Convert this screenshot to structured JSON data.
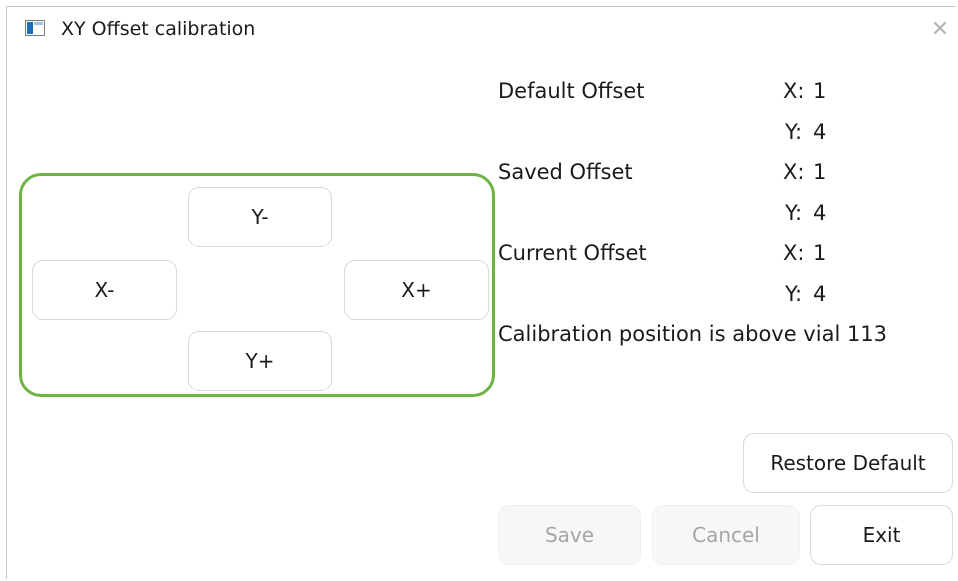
{
  "window": {
    "title": "XY Offset calibration",
    "close_glyph": "✕"
  },
  "jog": {
    "y_minus": "Y-",
    "x_minus": "X-",
    "x_plus": "X+",
    "y_plus": "Y+"
  },
  "offsets": {
    "default": {
      "label": "Default Offset",
      "x_label": "X:",
      "x": "1",
      "y_label": "Y:",
      "y": "4"
    },
    "saved": {
      "label": "Saved Offset",
      "x_label": "X:",
      "x": "1",
      "y_label": "Y:",
      "y": "4"
    },
    "current": {
      "label": "Current Offset",
      "x_label": "X:",
      "x": "1",
      "y_label": "Y:",
      "y": "4"
    }
  },
  "status": "Calibration position is above vial 113",
  "buttons": {
    "restore_default": "Restore Default",
    "save": "Save",
    "cancel": "Cancel",
    "exit": "Exit"
  },
  "colors": {
    "group_border": "#6fb443",
    "disabled_text": "#a5a5a5"
  }
}
